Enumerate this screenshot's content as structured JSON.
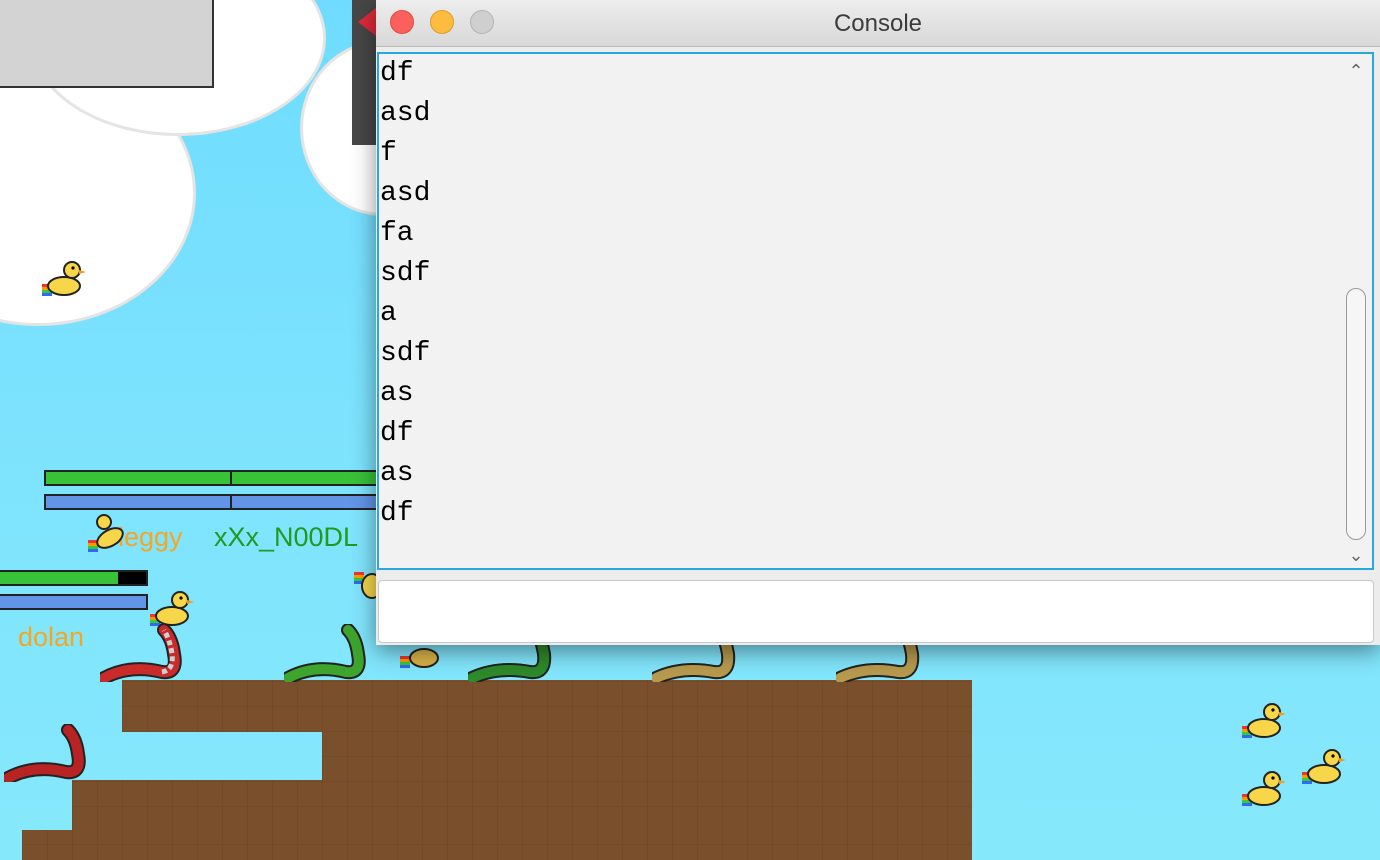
{
  "window": {
    "title": "Console",
    "close_label": "close",
    "minimize_label": "minimize",
    "zoom_label": "zoom"
  },
  "console": {
    "output_lines": [
      "df",
      "asd",
      "f",
      "asd",
      "fa",
      "sdf",
      "a",
      "sdf",
      "as",
      "df",
      "as",
      "df"
    ],
    "input_value": "",
    "input_placeholder": ""
  },
  "players": [
    {
      "name": "leggy",
      "color": "#f5a623"
    },
    {
      "name": "xXx_N00DL",
      "color": "#1e9c1e"
    },
    {
      "name": "dolan",
      "color": "#f5a623"
    }
  ],
  "colors": {
    "sky": "#7fe4fd",
    "dirt": "#7a4f2b",
    "health_bar": "#38c238",
    "mana_bar": "#6295e8",
    "console_focus_border": "#29a8e0",
    "close_button": "#fc605c",
    "minimize_button": "#fdbc40"
  },
  "icons": {
    "duck": "rubber-duck-icon",
    "snake": "snake-character-icon"
  }
}
